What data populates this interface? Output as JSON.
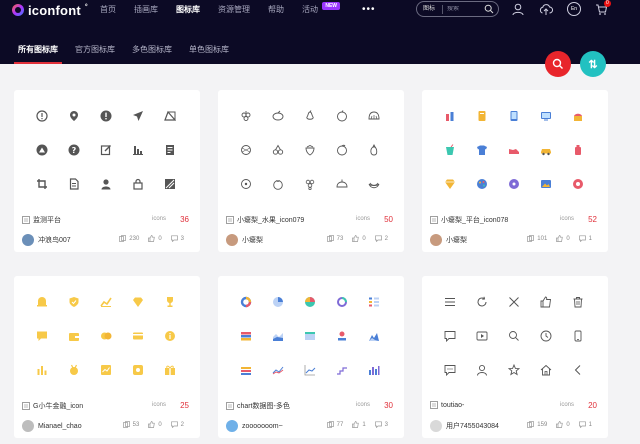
{
  "header": {
    "logo_text": "iconfont",
    "logo_mark": "°",
    "nav": [
      {
        "label": "首页",
        "active": false
      },
      {
        "label": "插画库",
        "active": false
      },
      {
        "label": "图标库",
        "active": true
      },
      {
        "label": "资源管理",
        "active": false
      },
      {
        "label": "帮助",
        "active": false
      },
      {
        "label": "活动",
        "active": false,
        "badge": "NEW"
      }
    ],
    "more_label": "•••",
    "search": {
      "scope": "图标",
      "placeholder": "搜索",
      "value": ""
    },
    "lang_label": "En",
    "cart_count": "0"
  },
  "subnav": [
    {
      "label": "所有图标库",
      "active": true
    },
    {
      "label": "官方图标库",
      "active": false
    },
    {
      "label": "多色图标库",
      "active": false
    },
    {
      "label": "单色图标库",
      "active": false
    }
  ],
  "fab": {
    "sort_label": "⇅"
  },
  "cards": [
    {
      "title": "监测平台",
      "icons_label": "icons",
      "count": "36",
      "author": "冲浪鸟007",
      "collects": "230",
      "likes": "0",
      "comments": "3",
      "avatar_color": "#6b8fb8"
    },
    {
      "title": "小瘪梨_水果_icon079",
      "icons_label": "icons",
      "count": "50",
      "author": "小瘪梨",
      "collects": "73",
      "likes": "0",
      "comments": "2",
      "avatar_color": "#c79a7e"
    },
    {
      "title": "小瘪梨_平台_icon078",
      "icons_label": "icons",
      "count": "52",
      "author": "小瘪梨",
      "collects": "101",
      "likes": "0",
      "comments": "1",
      "avatar_color": "#c79a7e"
    },
    {
      "title": "G小牛金融_icon",
      "icons_label": "icons",
      "count": "25",
      "author": "Mianael_chao",
      "collects": "53",
      "likes": "0",
      "comments": "2",
      "avatar_color": "#bdbdbd"
    },
    {
      "title": "chart数据图-多色",
      "icons_label": "icons",
      "count": "30",
      "author": "zooooooom~",
      "collects": "77",
      "likes": "1",
      "comments": "3",
      "avatar_color": "#6fb0e8"
    },
    {
      "title": "toutiao-",
      "icons_label": "icons",
      "count": "20",
      "author": "用户7455043084",
      "collects": "159",
      "likes": "0",
      "comments": "1",
      "avatar_color": "#d9d9d9"
    }
  ],
  "colors": {
    "header_bg": "#0c0a25",
    "accent_red": "#e0303a",
    "accent_teal": "#22c1c1",
    "card_yellow": "#f7c948"
  }
}
